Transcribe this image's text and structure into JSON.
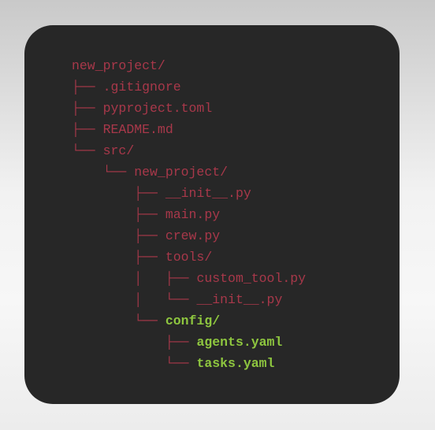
{
  "tree": {
    "lines": [
      {
        "prefix": "",
        "name": "new_project/"
      },
      {
        "prefix": "├── ",
        "name": ".gitignore"
      },
      {
        "prefix": "├── ",
        "name": "pyproject.toml"
      },
      {
        "prefix": "├── ",
        "name": "README.md"
      },
      {
        "prefix": "└── ",
        "name": "src/"
      },
      {
        "prefix": "    └── ",
        "name": "new_project/"
      },
      {
        "prefix": "        ├── ",
        "name": "__init__.py"
      },
      {
        "prefix": "        ├── ",
        "name": "main.py"
      },
      {
        "prefix": "        ├── ",
        "name": "crew.py"
      },
      {
        "prefix": "        ├── ",
        "name": "tools/"
      },
      {
        "prefix": "        │   ├── ",
        "name": "custom_tool.py"
      },
      {
        "prefix": "        │   └── ",
        "name": "__init__.py"
      },
      {
        "prefix": "        └── ",
        "name": "config/"
      },
      {
        "prefix": "            ├── ",
        "name": "agents.yaml"
      },
      {
        "prefix": "            └── ",
        "name": "tasks.yaml"
      }
    ]
  },
  "colors": {
    "background_terminal": "#272727",
    "text_red": "#a8384a",
    "text_green": "#8ec63f"
  }
}
